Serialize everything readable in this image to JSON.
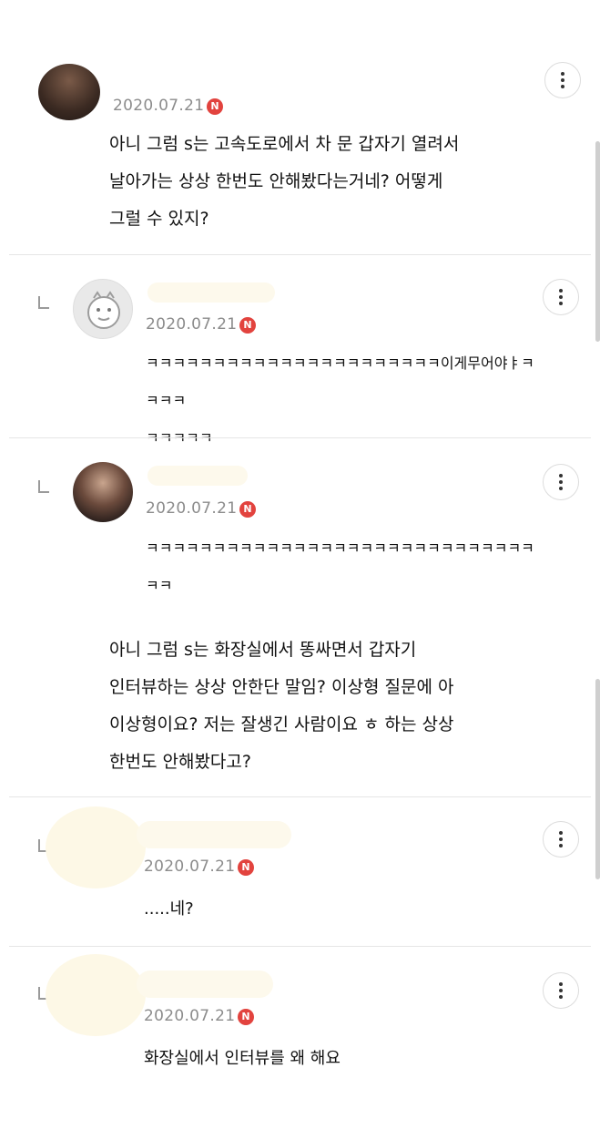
{
  "comments": [
    {
      "date": "2020.07.21",
      "badge": "N",
      "text": "아니 그럼 s는 고속도로에서 차 문 갑자기 열려서\n날아가는 상상 한번도 안해봤다는거네? 어떻게\n그럴 수 있지?"
    },
    {
      "date": "2020.07.21",
      "badge": "N",
      "text": "ㅋㅋㅋㅋㅋㅋㅋㅋㅋㅋㅋㅋㅋㅋㅋㅋㅋㅋㅋㅋㅋㅋ이게무어야ㅑㅋㅋㅋㅋ\nㅋㅋㅋㅋㅋ"
    },
    {
      "date": "2020.07.21",
      "badge": "N",
      "line1": "ㅋㅋㅋㅋㅋㅋㅋㅋㅋㅋㅋㅋㅋㅋㅋㅋㅋㅋㅋㅋㅋㅋㅋㅋㅋㅋㅋㅋㅋㅋㅋ",
      "text": "아니 그럼 s는 화장실에서 똥싸면서 갑자기\n인터뷰하는 상상 안한단 말임? 이상형 질문에 아\n이상형이요? 저는 잘생긴 사람이요 ㅎ 하는 상상\n한번도 안해봤다고?"
    },
    {
      "date": "2020.07.21",
      "badge": "N",
      "text": ".....네?"
    },
    {
      "date": "2020.07.21",
      "badge": "N",
      "text": "화장실에서 인터뷰를 왜 해요"
    }
  ],
  "icons": {
    "more": "more-vertical-icon",
    "reply": "reply-arrow-icon",
    "new": "new-badge-icon"
  },
  "colors": {
    "badge": "#e2433e",
    "date": "#8c8c8c",
    "divider": "#e6e6e6"
  }
}
